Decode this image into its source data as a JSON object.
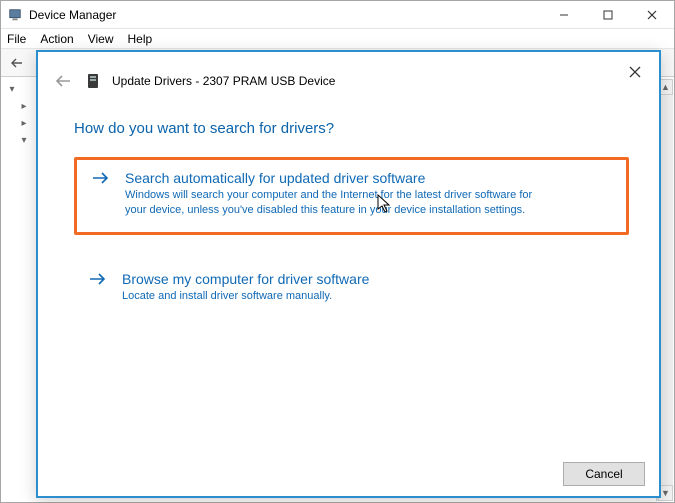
{
  "devmgr": {
    "title": "Device Manager",
    "menus": {
      "file": "File",
      "action": "Action",
      "view": "View",
      "help": "Help"
    }
  },
  "dialog": {
    "header_title": "Update Drivers - 2307 PRAM USB Device",
    "question": "How do you want to search for drivers?",
    "options": [
      {
        "title": "Search automatically for updated driver software",
        "desc": "Windows will search your computer and the Internet for the latest driver software for your device, unless you've disabled this feature in your device installation settings."
      },
      {
        "title": "Browse my computer for driver software",
        "desc": "Locate and install driver software manually."
      }
    ],
    "cancel_label": "Cancel"
  }
}
